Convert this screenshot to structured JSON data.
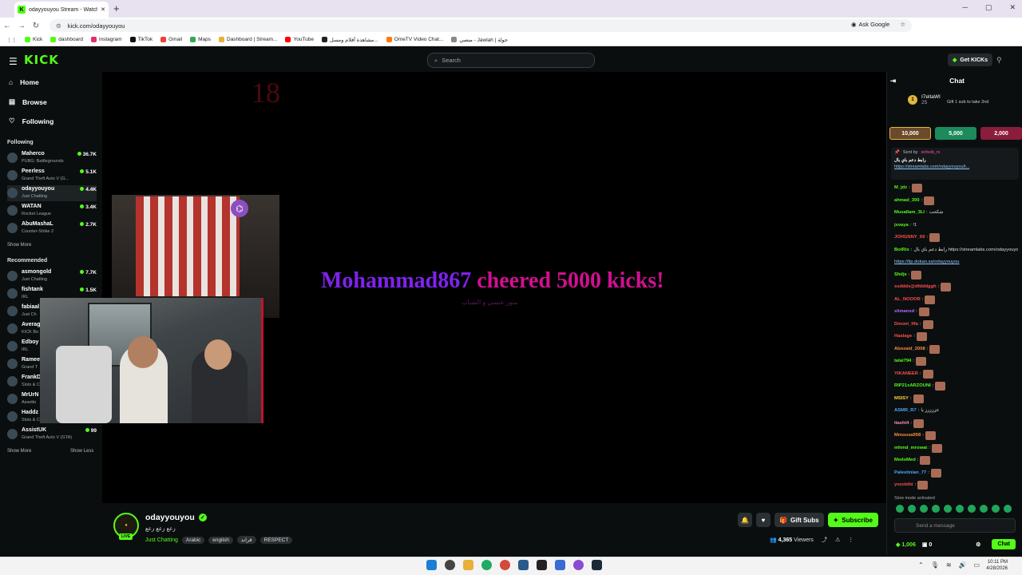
{
  "browser": {
    "tab_title": "odayyouyou Stream - Watch Li...",
    "new_tab": "+",
    "url": "kick.com/odayyouyou",
    "ask_google": "Ask Google",
    "bookmarks": [
      "Kick",
      "dashboard",
      "instagram",
      "TikTok",
      "Gmail",
      "Maps",
      "Dashboard | Stream...",
      "YouTube",
      "مشاهدة أفلام ومسل...",
      "OmeTV Video Chat...",
      "منصي - Jawlah | جولة"
    ]
  },
  "header": {
    "logo": "KICK",
    "search_placeholder": "Search",
    "get_kicks": "Get KICKs"
  },
  "sidebar": {
    "nav": [
      {
        "label": "Home",
        "icon": "home-icon"
      },
      {
        "label": "Browse",
        "icon": "browse-icon"
      },
      {
        "label": "Following",
        "icon": "heart-icon"
      }
    ],
    "following_title": "Following",
    "following": [
      {
        "name": "Maherco",
        "category": "PUBG: Battlegrounds",
        "viewers": "36.7K"
      },
      {
        "name": "Peerless",
        "category": "Grand Theft Auto V (G...",
        "viewers": "5.1K"
      },
      {
        "name": "odayyouyou",
        "category": "Just Chatting",
        "viewers": "4.4K"
      },
      {
        "name": "WATAN",
        "category": "Rocket League",
        "viewers": "3.4K"
      },
      {
        "name": "AbuMashaL",
        "category": "Counter-Strike 2",
        "viewers": "2.7K"
      }
    ],
    "show_more": "Show More",
    "recommended_title": "Recommended",
    "recommended": [
      {
        "name": "asmongold",
        "category": "Just Chatting",
        "viewers": "7.7K"
      },
      {
        "name": "fishtank",
        "category": "IRL",
        "viewers": "1.5K"
      },
      {
        "name": "fabiaal",
        "category": "Just Ch",
        "viewers": ""
      },
      {
        "name": "Averag",
        "category": "KICK Bo",
        "viewers": ""
      },
      {
        "name": "Edboy",
        "category": "IRL",
        "viewers": ""
      },
      {
        "name": "Ramee",
        "category": "Grand T",
        "viewers": ""
      },
      {
        "name": "FrankD",
        "category": "Slots & C",
        "viewers": ""
      },
      {
        "name": "MrUrN",
        "category": "Assetto",
        "viewers": ""
      },
      {
        "name": "Haddz",
        "category": "Slots & C",
        "viewers": ""
      },
      {
        "name": "AssistUK",
        "category": "Grand Theft Auto V (GTA)",
        "viewers": "99"
      }
    ],
    "show_more2": "Show More",
    "show_less": "Show Less"
  },
  "video": {
    "corner_number": "18",
    "cheer_user": "Mohammad867",
    "cheer_text": "cheered 5000 kicks!",
    "cheer_sub": "منور عنسي و الشباب"
  },
  "stream": {
    "name": "odayyouyou",
    "title": "زعع زعع زعع",
    "live": "LIVE",
    "category": "Just Chatting",
    "tags": [
      "Arabic",
      "english",
      "قراند",
      "RESPECT"
    ],
    "gift_subs": "Gift Subs",
    "subscribe": "Subscribe",
    "viewers": "4,365",
    "viewers_label": "Viewers"
  },
  "chat": {
    "title": "Chat",
    "top_gifter": "I7eltaWI",
    "top_gifter_count": "25",
    "gift_prompt": "Gift 1 sub to take 2nd",
    "kick_tiers": [
      "10,000",
      "5,000",
      "2,000"
    ],
    "pinned_sent_by": "Sent by",
    "pinned_user": "soheib_rs",
    "pinned_text": "رابط دعم باي بال",
    "pinned_link": "https://streamlabs.com/odayyouyou/t...",
    "messages": [
      {
        "user": "M_jdz",
        "color": "#53fc18",
        "text": ""
      },
      {
        "user": "ahmad_300",
        "color": "#53fc18",
        "text": ""
      },
      {
        "user": "Musallam_3LI",
        "color": "#53fc18",
        "text": "شكحت"
      },
      {
        "user": "jsvaya",
        "color": "#53fc18",
        "text": "!1"
      },
      {
        "user": "JOHGNNY_69",
        "color": "#ff4d4d",
        "text": ""
      },
      {
        "user": "BotRix",
        "color": "#53fc18",
        "text": "رابط دعم باي بال https://streamlabs.com/odayyouyou/tip"
      },
      {
        "user": "",
        "color": "#53fc18",
        "text": "https://tip.dokan.sa/odayyouyou"
      },
      {
        "user": "Shdjs",
        "color": "#53fc18",
        "text": ""
      },
      {
        "user": "ssdddx@dfdddggh",
        "color": "#ff4d4d",
        "text": ""
      },
      {
        "user": "AL_NOOOR",
        "color": "#ff4d4d",
        "text": ""
      },
      {
        "user": "slimanxd",
        "color": "#b46bff",
        "text": ""
      },
      {
        "user": "Dmoni_fifa",
        "color": "#ff4d4d",
        "text": ""
      },
      {
        "user": "Haalage",
        "color": "#ff4d4d",
        "text": ""
      },
      {
        "user": "Abozaid_2008",
        "color": "#ff8a3d",
        "text": ""
      },
      {
        "user": "talai794",
        "color": "#53fc18",
        "text": ""
      },
      {
        "user": "YIKANEER",
        "color": "#ff4d4d",
        "text": ""
      },
      {
        "user": "RIP21xARZOUNI",
        "color": "#53fc18",
        "text": ""
      },
      {
        "user": "MSISY",
        "color": "#ffd23d",
        "text": ""
      },
      {
        "user": "ASMR_R7",
        "color": "#4da6ff",
        "text": "عززززز يا"
      },
      {
        "user": "itashi4",
        "color": "#ff8ab4",
        "text": ""
      },
      {
        "user": "Mmousa958",
        "color": "#ff8a3d",
        "text": ""
      },
      {
        "user": "mhmd_mrowat",
        "color": "#53fc18",
        "text": ""
      },
      {
        "user": "MedoMed",
        "color": "#53fc18",
        "text": ""
      },
      {
        "user": "Palestinian_77",
        "color": "#4da6ff",
        "text": ""
      },
      {
        "user": "yozobibi",
        "color": "#ff4d4d",
        "text": ""
      }
    ],
    "slow_mode": "Slow mode activated",
    "input_placeholder": "Send a message",
    "kicks_count": "1,006",
    "zero": "0",
    "chat_button": "Chat"
  },
  "taskbar": {
    "time": "10:11 PM",
    "date": "4/28/2026"
  }
}
